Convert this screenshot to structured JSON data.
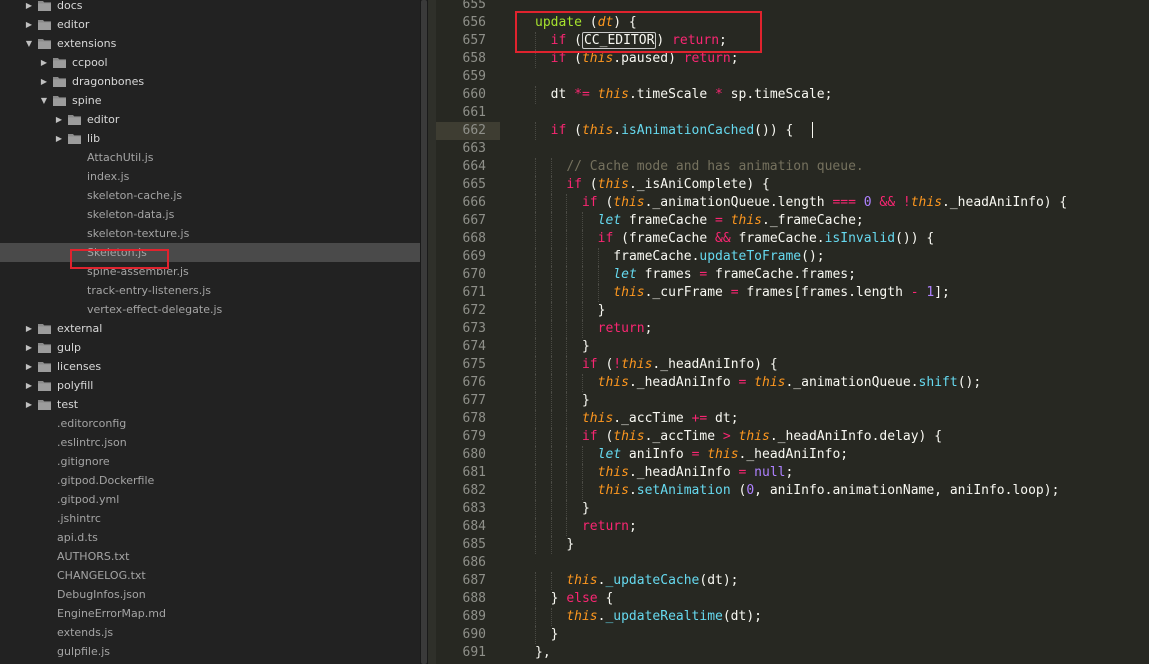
{
  "sidebar": {
    "items": [
      {
        "label": "docs",
        "type": "folder",
        "depth": 1,
        "expanded": false
      },
      {
        "label": "editor",
        "type": "folder",
        "depth": 1,
        "expanded": false
      },
      {
        "label": "extensions",
        "type": "folder",
        "depth": 1,
        "expanded": true
      },
      {
        "label": "ccpool",
        "type": "folder",
        "depth": 2,
        "expanded": false
      },
      {
        "label": "dragonbones",
        "type": "folder",
        "depth": 2,
        "expanded": false
      },
      {
        "label": "spine",
        "type": "folder",
        "depth": 2,
        "expanded": true
      },
      {
        "label": "editor",
        "type": "folder",
        "depth": 3,
        "expanded": false
      },
      {
        "label": "lib",
        "type": "folder",
        "depth": 3,
        "expanded": false
      },
      {
        "label": "AttachUtil.js",
        "type": "file",
        "depth": 3
      },
      {
        "label": "index.js",
        "type": "file",
        "depth": 3
      },
      {
        "label": "skeleton-cache.js",
        "type": "file",
        "depth": 3
      },
      {
        "label": "skeleton-data.js",
        "type": "file",
        "depth": 3
      },
      {
        "label": "skeleton-texture.js",
        "type": "file",
        "depth": 3
      },
      {
        "label": "Skeleton.js",
        "type": "file",
        "depth": 3,
        "selected": true
      },
      {
        "label": "spine-assembler.js",
        "type": "file",
        "depth": 3
      },
      {
        "label": "track-entry-listeners.js",
        "type": "file",
        "depth": 3
      },
      {
        "label": "vertex-effect-delegate.js",
        "type": "file",
        "depth": 3
      },
      {
        "label": "external",
        "type": "folder",
        "depth": 1,
        "expanded": false
      },
      {
        "label": "gulp",
        "type": "folder",
        "depth": 1,
        "expanded": false
      },
      {
        "label": "licenses",
        "type": "folder",
        "depth": 1,
        "expanded": false
      },
      {
        "label": "polyfill",
        "type": "folder",
        "depth": 1,
        "expanded": false
      },
      {
        "label": "test",
        "type": "folder",
        "depth": 1,
        "expanded": false
      },
      {
        "label": ".editorconfig",
        "type": "file",
        "depth": 1
      },
      {
        "label": ".eslintrc.json",
        "type": "file",
        "depth": 1
      },
      {
        "label": ".gitignore",
        "type": "file",
        "depth": 1
      },
      {
        "label": ".gitpod.Dockerfile",
        "type": "file",
        "depth": 1
      },
      {
        "label": ".gitpod.yml",
        "type": "file",
        "depth": 1
      },
      {
        "label": ".jshintrc",
        "type": "file",
        "depth": 1
      },
      {
        "label": "api.d.ts",
        "type": "file",
        "depth": 1
      },
      {
        "label": "AUTHORS.txt",
        "type": "file",
        "depth": 1
      },
      {
        "label": "CHANGELOG.txt",
        "type": "file",
        "depth": 1
      },
      {
        "label": "DebugInfos.json",
        "type": "file",
        "depth": 1
      },
      {
        "label": "EngineErrorMap.md",
        "type": "file",
        "depth": 1
      },
      {
        "label": "extends.js",
        "type": "file",
        "depth": 1
      },
      {
        "label": "gulpfile.js",
        "type": "file",
        "depth": 1
      }
    ]
  },
  "editor": {
    "current_line": 662,
    "lines": [
      {
        "n": 655,
        "indent": 2,
        "tokens": []
      },
      {
        "n": 656,
        "indent": 2,
        "tokens": [
          [
            "fn",
            "update"
          ],
          [
            "p",
            " ("
          ],
          [
            "par",
            "dt"
          ],
          [
            "p",
            ") {"
          ]
        ]
      },
      {
        "n": 657,
        "indent": 4,
        "tokens": [
          [
            "kw",
            "if"
          ],
          [
            "p",
            " ("
          ],
          [
            "sel",
            "CC_EDITOR"
          ],
          [
            "p",
            ") "
          ],
          [
            "kw",
            "return"
          ],
          [
            "p",
            ";"
          ]
        ]
      },
      {
        "n": 658,
        "indent": 4,
        "tokens": [
          [
            "kw",
            "if"
          ],
          [
            "p",
            " ("
          ],
          [
            "this",
            "this"
          ],
          [
            "p",
            ".paused) "
          ],
          [
            "kw",
            "return"
          ],
          [
            "p",
            ";"
          ]
        ]
      },
      {
        "n": 659,
        "indent": 4,
        "tokens": []
      },
      {
        "n": 660,
        "indent": 4,
        "tokens": [
          [
            "p",
            "dt "
          ],
          [
            "kw",
            "*="
          ],
          [
            "p",
            " "
          ],
          [
            "this",
            "this"
          ],
          [
            "p",
            ".timeScale "
          ],
          [
            "kw",
            "*"
          ],
          [
            "p",
            " sp.timeScale;"
          ]
        ]
      },
      {
        "n": 661,
        "indent": 4,
        "tokens": []
      },
      {
        "n": 662,
        "indent": 4,
        "tokens": [
          [
            "kw",
            "if"
          ],
          [
            "p",
            " ("
          ],
          [
            "this",
            "this"
          ],
          [
            "p",
            "."
          ],
          [
            "sup",
            "isAnimationCached"
          ],
          [
            "p",
            "()) {"
          ]
        ]
      },
      {
        "n": 663,
        "indent": 4,
        "tokens": []
      },
      {
        "n": 664,
        "indent": 6,
        "tokens": [
          [
            "cm",
            "// Cache mode and has animation queue."
          ]
        ]
      },
      {
        "n": 665,
        "indent": 6,
        "tokens": [
          [
            "kw",
            "if"
          ],
          [
            "p",
            " ("
          ],
          [
            "this",
            "this"
          ],
          [
            "p",
            "._isAniComplete) {"
          ]
        ]
      },
      {
        "n": 666,
        "indent": 8,
        "tokens": [
          [
            "kw",
            "if"
          ],
          [
            "p",
            " ("
          ],
          [
            "this",
            "this"
          ],
          [
            "p",
            "._animationQueue.length "
          ],
          [
            "kw",
            "==="
          ],
          [
            "p",
            " "
          ],
          [
            "num",
            "0"
          ],
          [
            "p",
            " "
          ],
          [
            "kw",
            "&&"
          ],
          [
            "p",
            " "
          ],
          [
            "kw",
            "!"
          ],
          [
            "this",
            "this"
          ],
          [
            "p",
            "._headAniInfo) {"
          ]
        ]
      },
      {
        "n": 667,
        "indent": 10,
        "tokens": [
          [
            "st",
            "let"
          ],
          [
            "p",
            " frameCache "
          ],
          [
            "kw",
            "="
          ],
          [
            "p",
            " "
          ],
          [
            "this",
            "this"
          ],
          [
            "p",
            "._frameCache;"
          ]
        ]
      },
      {
        "n": 668,
        "indent": 10,
        "tokens": [
          [
            "kw",
            "if"
          ],
          [
            "p",
            " (frameCache "
          ],
          [
            "kw",
            "&&"
          ],
          [
            "p",
            " frameCache."
          ],
          [
            "sup",
            "isInvalid"
          ],
          [
            "p",
            "()) {"
          ]
        ]
      },
      {
        "n": 669,
        "indent": 12,
        "tokens": [
          [
            "p",
            "frameCache."
          ],
          [
            "sup",
            "updateToFrame"
          ],
          [
            "p",
            "();"
          ]
        ]
      },
      {
        "n": 670,
        "indent": 12,
        "tokens": [
          [
            "st",
            "let"
          ],
          [
            "p",
            " frames "
          ],
          [
            "kw",
            "="
          ],
          [
            "p",
            " frameCache.frames;"
          ]
        ]
      },
      {
        "n": 671,
        "indent": 12,
        "tokens": [
          [
            "this",
            "this"
          ],
          [
            "p",
            "._curFrame "
          ],
          [
            "kw",
            "="
          ],
          [
            "p",
            " frames[frames.length "
          ],
          [
            "kw",
            "-"
          ],
          [
            "p",
            " "
          ],
          [
            "num",
            "1"
          ],
          [
            "p",
            "];"
          ]
        ]
      },
      {
        "n": 672,
        "indent": 10,
        "tokens": [
          [
            "p",
            "}"
          ]
        ]
      },
      {
        "n": 673,
        "indent": 10,
        "tokens": [
          [
            "kw",
            "return"
          ],
          [
            "p",
            ";"
          ]
        ]
      },
      {
        "n": 674,
        "indent": 8,
        "tokens": [
          [
            "p",
            "}"
          ]
        ]
      },
      {
        "n": 675,
        "indent": 8,
        "tokens": [
          [
            "kw",
            "if"
          ],
          [
            "p",
            " ("
          ],
          [
            "kw",
            "!"
          ],
          [
            "this",
            "this"
          ],
          [
            "p",
            "._headAniInfo) {"
          ]
        ]
      },
      {
        "n": 676,
        "indent": 10,
        "tokens": [
          [
            "this",
            "this"
          ],
          [
            "p",
            "._headAniInfo "
          ],
          [
            "kw",
            "="
          ],
          [
            "p",
            " "
          ],
          [
            "this",
            "this"
          ],
          [
            "p",
            "._animationQueue."
          ],
          [
            "sup",
            "shift"
          ],
          [
            "p",
            "();"
          ]
        ]
      },
      {
        "n": 677,
        "indent": 8,
        "tokens": [
          [
            "p",
            "}"
          ]
        ]
      },
      {
        "n": 678,
        "indent": 8,
        "tokens": [
          [
            "this",
            "this"
          ],
          [
            "p",
            "._accTime "
          ],
          [
            "kw",
            "+="
          ],
          [
            "p",
            " dt;"
          ]
        ]
      },
      {
        "n": 679,
        "indent": 8,
        "tokens": [
          [
            "kw",
            "if"
          ],
          [
            "p",
            " ("
          ],
          [
            "this",
            "this"
          ],
          [
            "p",
            "._accTime "
          ],
          [
            "kw",
            ">"
          ],
          [
            "p",
            " "
          ],
          [
            "this",
            "this"
          ],
          [
            "p",
            "._headAniInfo.delay) {"
          ]
        ]
      },
      {
        "n": 680,
        "indent": 10,
        "tokens": [
          [
            "st",
            "let"
          ],
          [
            "p",
            " aniInfo "
          ],
          [
            "kw",
            "="
          ],
          [
            "p",
            " "
          ],
          [
            "this",
            "this"
          ],
          [
            "p",
            "._headAniInfo;"
          ]
        ]
      },
      {
        "n": 681,
        "indent": 10,
        "tokens": [
          [
            "this",
            "this"
          ],
          [
            "p",
            "._headAniInfo "
          ],
          [
            "kw",
            "="
          ],
          [
            "p",
            " "
          ],
          [
            "num",
            "null"
          ],
          [
            "p",
            ";"
          ]
        ]
      },
      {
        "n": 682,
        "indent": 10,
        "tokens": [
          [
            "this",
            "this"
          ],
          [
            "p",
            "."
          ],
          [
            "sup",
            "setAnimation"
          ],
          [
            "p",
            " ("
          ],
          [
            "num",
            "0"
          ],
          [
            "p",
            ", aniInfo.animationName, aniInfo.loop);"
          ]
        ]
      },
      {
        "n": 683,
        "indent": 8,
        "tokens": [
          [
            "p",
            "}"
          ]
        ]
      },
      {
        "n": 684,
        "indent": 8,
        "tokens": [
          [
            "kw",
            "return"
          ],
          [
            "p",
            ";"
          ]
        ]
      },
      {
        "n": 685,
        "indent": 6,
        "tokens": [
          [
            "p",
            "}"
          ]
        ]
      },
      {
        "n": 686,
        "indent": 6,
        "tokens": []
      },
      {
        "n": 687,
        "indent": 6,
        "tokens": [
          [
            "this",
            "this"
          ],
          [
            "p",
            "."
          ],
          [
            "sup",
            "_updateCache"
          ],
          [
            "p",
            "(dt);"
          ]
        ]
      },
      {
        "n": 688,
        "indent": 4,
        "tokens": [
          [
            "p",
            "} "
          ],
          [
            "kw",
            "else"
          ],
          [
            "p",
            " {"
          ]
        ]
      },
      {
        "n": 689,
        "indent": 6,
        "tokens": [
          [
            "this",
            "this"
          ],
          [
            "p",
            "."
          ],
          [
            "sup",
            "_updateRealtime"
          ],
          [
            "p",
            "(dt);"
          ]
        ]
      },
      {
        "n": 690,
        "indent": 4,
        "tokens": [
          [
            "p",
            "}"
          ]
        ]
      },
      {
        "n": 691,
        "indent": 2,
        "tokens": [
          [
            "p",
            "},"
          ]
        ]
      }
    ]
  },
  "colors": {
    "sidebar_bg": "#222222",
    "editor_bg": "#272822",
    "highlight_box": "#e0232e",
    "keyword": "#f92672",
    "function": "#a6e22e",
    "this": "#fd971f",
    "storage": "#66d9ef",
    "number": "#ae81ff",
    "comment": "#75715e"
  },
  "icons": {
    "folder": "folder-icon",
    "expand": "chevron-right-icon",
    "collapse": "chevron-down-icon"
  }
}
